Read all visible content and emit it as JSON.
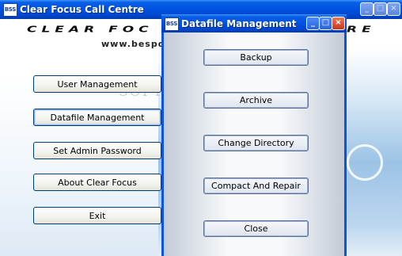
{
  "main_window": {
    "title": "Clear Focus Call Centre",
    "icon_label": "BSS",
    "controls": {
      "minimize": "_",
      "maximize": "□",
      "close": "×"
    },
    "banner": {
      "logo_text_left": "CLEAR FOC",
      "logo_text_right": "RE",
      "url_text": "www.bespo"
    },
    "watermark": "SOFTPEDIA",
    "buttons": [
      {
        "label": "User Management"
      },
      {
        "label": "Datafile Management"
      },
      {
        "label": "Set Admin Password"
      },
      {
        "label": "About Clear Focus"
      },
      {
        "label": "Exit"
      }
    ]
  },
  "dialog": {
    "title": "Datafile Management",
    "icon_label": "BSS",
    "controls": {
      "minimize": "_",
      "maximize": "□",
      "close": "×"
    },
    "buttons": [
      {
        "label": "Backup"
      },
      {
        "label": "Archive"
      },
      {
        "label": "Change Directory"
      },
      {
        "label": "Compact And Repair"
      },
      {
        "label": "Close"
      }
    ]
  },
  "colors": {
    "titlebar": "#0054e3",
    "close_button": "#c6381a",
    "button_border": "#003c74",
    "sky": "#9cc3e6"
  }
}
